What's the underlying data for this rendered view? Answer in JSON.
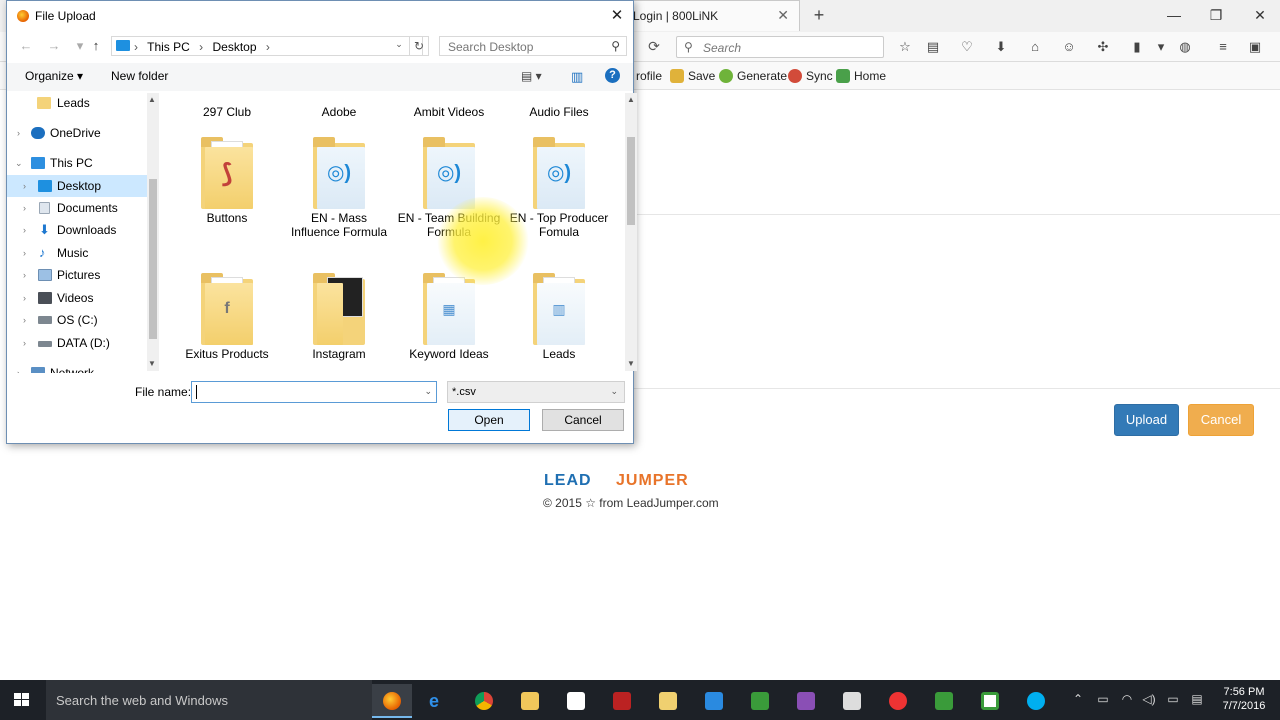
{
  "browser": {
    "active_tab": "Login | 800LiNK",
    "search_placeholder": "Search",
    "bookmarks": [
      {
        "label": "rofile"
      },
      {
        "label": "Save"
      },
      {
        "label": "Generate"
      },
      {
        "label": "Sync"
      },
      {
        "label": "Home"
      }
    ]
  },
  "page": {
    "upload_label": "Upload",
    "cancel_label": "Cancel",
    "logo_part1": "LEAD",
    "logo_part2": "JUMPER",
    "copyright": "© 2015 ☆ from LeadJumper.com"
  },
  "dialog": {
    "title": "File Upload",
    "breadcrumb": [
      "This PC",
      "Desktop"
    ],
    "search_placeholder": "Search Desktop",
    "organize_label": "Organize ▾",
    "new_folder_label": "New folder",
    "nav_items": [
      {
        "label": "Leads"
      },
      {
        "label": "OneDrive"
      },
      {
        "label": "This PC"
      },
      {
        "label": "Desktop"
      },
      {
        "label": "Documents"
      },
      {
        "label": "Downloads"
      },
      {
        "label": "Music"
      },
      {
        "label": "Pictures"
      },
      {
        "label": "Videos"
      },
      {
        "label": "OS (C:)"
      },
      {
        "label": "DATA (D:)"
      },
      {
        "label": "Network"
      }
    ],
    "files": [
      {
        "label": "297 Club"
      },
      {
        "label": "Adobe"
      },
      {
        "label": "Ambit Videos"
      },
      {
        "label": "Audio Files"
      },
      {
        "label": "Buttons"
      },
      {
        "label": "EN - Mass Influence Formula"
      },
      {
        "label": "EN - Team Building Formula"
      },
      {
        "label": "EN - Top Producer Fomula"
      },
      {
        "label": "Exitus Products"
      },
      {
        "label": "Instagram"
      },
      {
        "label": "Keyword Ideas"
      },
      {
        "label": "Leads"
      }
    ],
    "file_name_label": "File name:",
    "file_name_value": "",
    "filter_value": "*.csv",
    "open_label": "Open",
    "cancel_label": "Cancel"
  },
  "taskbar": {
    "search_placeholder": "Search the web and Windows",
    "time": "7:56 PM",
    "date": "7/7/2016"
  },
  "colors": {
    "upload_button": "#337ab7",
    "cancel_button": "#f0ad4e",
    "selection": "#cce8ff",
    "taskbar": "#1d2127"
  }
}
